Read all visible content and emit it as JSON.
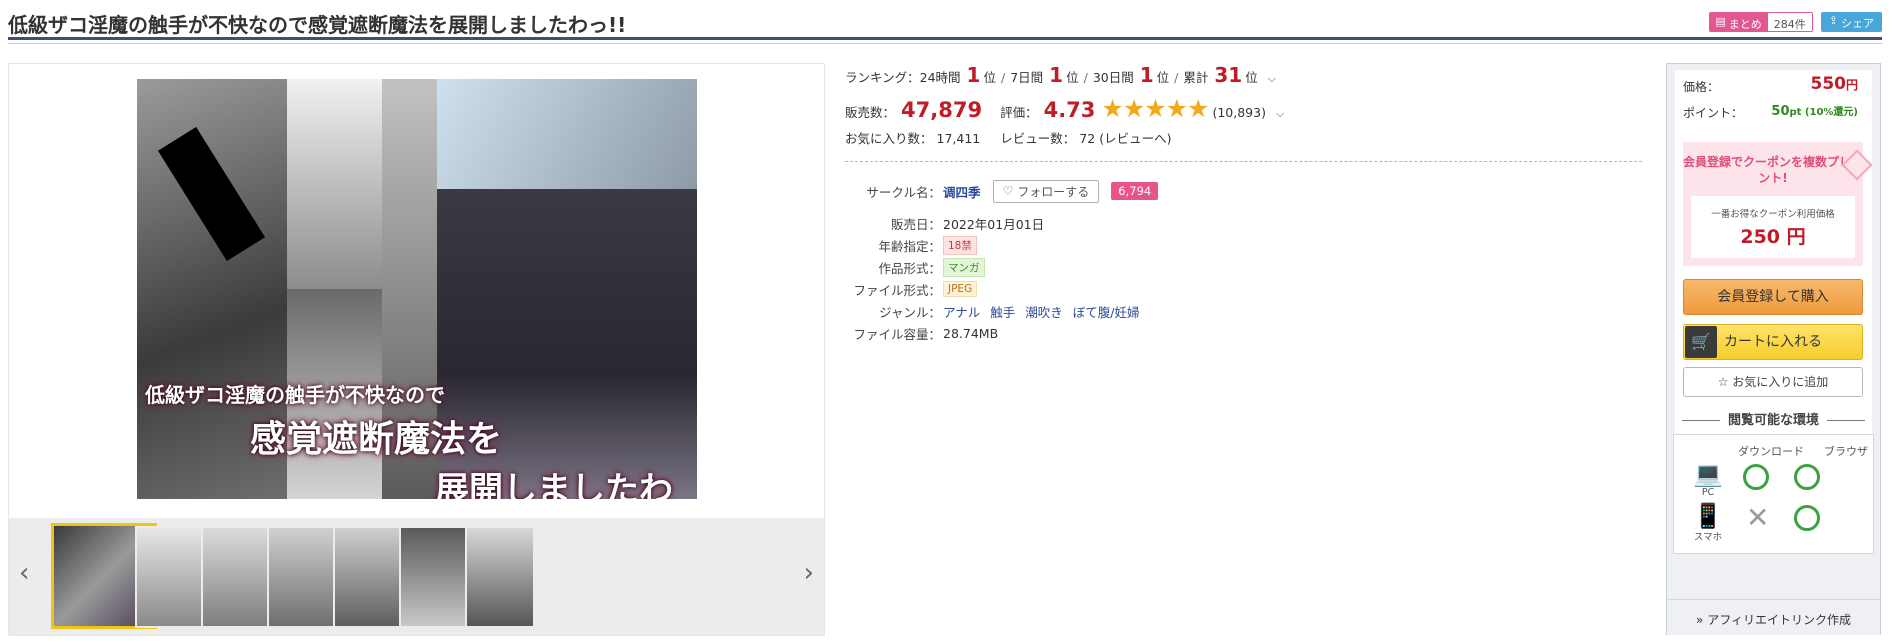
{
  "title": "低級ザコ淫魔の触手が不快なので感覚遮断魔法を展開しましたわっ!!",
  "header_actions": {
    "matome_label": "まとめ",
    "matome_count": "284件",
    "share_label": "シェア"
  },
  "cover": {
    "line1": "低級ザコ淫魔の触手が不快なので",
    "line2": "感覚遮断魔法を",
    "line3": "展開しましたわっ!!"
  },
  "gallery": {
    "prev_icon": "chevron-left-icon",
    "next_icon": "chevron-right-icon",
    "thumb_count": 7
  },
  "ranking": {
    "label": "ランキング：",
    "items": [
      {
        "period": "24時間",
        "rank": "1",
        "suffix": "位"
      },
      {
        "period": "7日間",
        "rank": "1",
        "suffix": "位"
      },
      {
        "period": "30日間",
        "rank": "1",
        "suffix": "位"
      },
      {
        "period": "累計",
        "rank": "31",
        "suffix": "位"
      }
    ]
  },
  "sales": {
    "label": "販売数：",
    "value": "47,879",
    "rating_label": "評価：",
    "rating_value": "4.73",
    "stars": "★★★★★",
    "rating_count": "(10,893)"
  },
  "favorites": {
    "label": "お気に入り数：",
    "value": "17,411",
    "review_label": "レビュー数：",
    "review_value": "72",
    "review_link": "(レビューへ)"
  },
  "spec": {
    "circle_label": "サークル名",
    "circle_name": "调四季",
    "follow_label": "フォローする",
    "follow_count": "6,794",
    "release_label": "販売日",
    "release_value": "2022年01月01日",
    "age_label": "年齢指定",
    "age_value": "18禁",
    "format_label": "作品形式",
    "format_value": "マンガ",
    "file_label": "ファイル形式",
    "file_value": "JPEG",
    "genre_label": "ジャンル",
    "genres": [
      "アナル",
      "触手",
      "潮吹き",
      "ぼて腹/妊婦"
    ],
    "size_label": "ファイル容量",
    "size_value": "28.74MB"
  },
  "sidebar": {
    "price_label": "価格：",
    "price_value": "550",
    "price_unit": "円",
    "point_label": "ポイント：",
    "point_value": "50",
    "point_unit": "pt (10%還元)",
    "coupon_title": "会員登録でクーポンを複数プレゼント!",
    "coupon_small": "一番お得なクーポン利用価格",
    "coupon_price": "250 円",
    "register_label": "会員登録して購入",
    "cart_label": "カートに入れる",
    "fav_label": "お気に入りに追加",
    "env_title": "閲覧可能な環境",
    "env_download": "ダウンロード",
    "env_browser": "ブラウザ",
    "env_pc": "PC",
    "env_phone": "スマホ",
    "affiliate_label": "アフィリエイトリンク作成"
  },
  "colors": {
    "accent_red": "#c01c28",
    "pink": "#e8538b",
    "star": "#f4a91a",
    "ok_green": "#3aa23f"
  }
}
